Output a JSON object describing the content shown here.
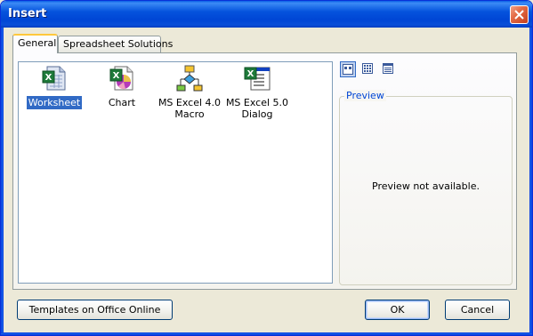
{
  "window": {
    "title": "Insert"
  },
  "tabs": [
    {
      "label": "General",
      "active": true
    },
    {
      "label": "Spreadsheet Solutions",
      "active": false
    }
  ],
  "items": [
    {
      "label": "Worksheet",
      "icon": "worksheet-icon",
      "selected": true
    },
    {
      "label": "Chart",
      "icon": "chart-icon",
      "selected": false
    },
    {
      "label": "MS Excel 4.0 Macro",
      "icon": "macro-icon",
      "selected": false
    },
    {
      "label": "MS Excel 5.0 Dialog",
      "icon": "dialog-icon",
      "selected": false
    }
  ],
  "view_buttons": [
    {
      "name": "large-icons-view",
      "active": true
    },
    {
      "name": "list-view",
      "active": false
    },
    {
      "name": "details-view",
      "active": false
    }
  ],
  "preview": {
    "legend": "Preview",
    "message": "Preview not available."
  },
  "buttons": {
    "templates": "Templates on Office Online",
    "ok": "OK",
    "cancel": "Cancel"
  },
  "colors": {
    "titlebar": "#0054e3",
    "selection": "#316ac5",
    "accent_tab": "#ffc83c",
    "close_button": "#e46b45"
  }
}
